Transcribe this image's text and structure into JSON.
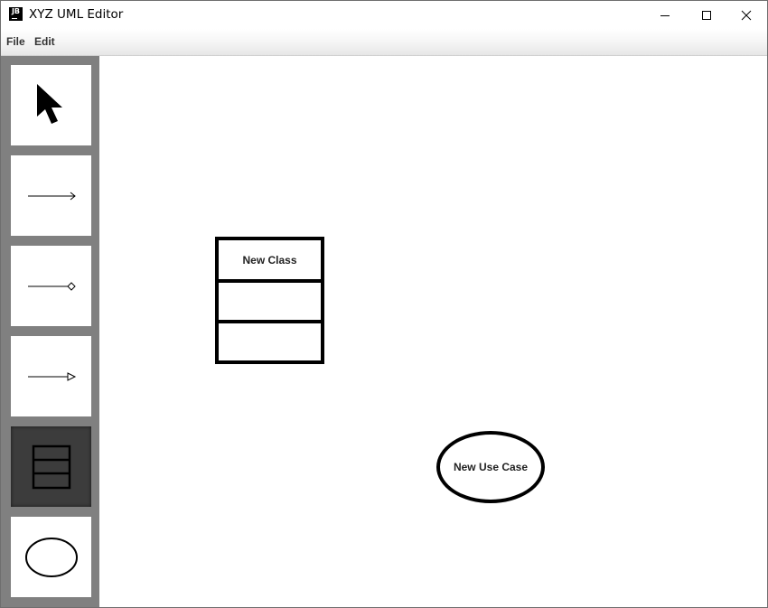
{
  "window": {
    "title": "XYZ UML Editor",
    "icon_text": "JB",
    "controls": [
      "minimize-icon",
      "maximize-icon",
      "close-icon"
    ]
  },
  "menu": {
    "items": [
      {
        "label": "File"
      },
      {
        "label": "Edit"
      }
    ]
  },
  "toolbar": {
    "tools": [
      {
        "name": "select",
        "icon": "cursor-arrow-icon",
        "selected": false
      },
      {
        "name": "association-line",
        "icon": "association-line-icon",
        "selected": false
      },
      {
        "name": "composition-line",
        "icon": "composition-line-icon",
        "selected": false
      },
      {
        "name": "generalization-line",
        "icon": "generalization-line-icon",
        "selected": false
      },
      {
        "name": "class",
        "icon": "class-shape-icon",
        "selected": true
      },
      {
        "name": "use-case",
        "icon": "use-case-ellipse-icon",
        "selected": false
      }
    ]
  },
  "canvas": {
    "objects": [
      {
        "type": "class",
        "label": "New Class"
      },
      {
        "type": "use-case",
        "label": "New Use Case"
      }
    ]
  },
  "colors": {
    "toolbar_bg": "#808080",
    "tool_selected_bg": "#3c3c3c",
    "canvas_bg": "#ffffff"
  }
}
